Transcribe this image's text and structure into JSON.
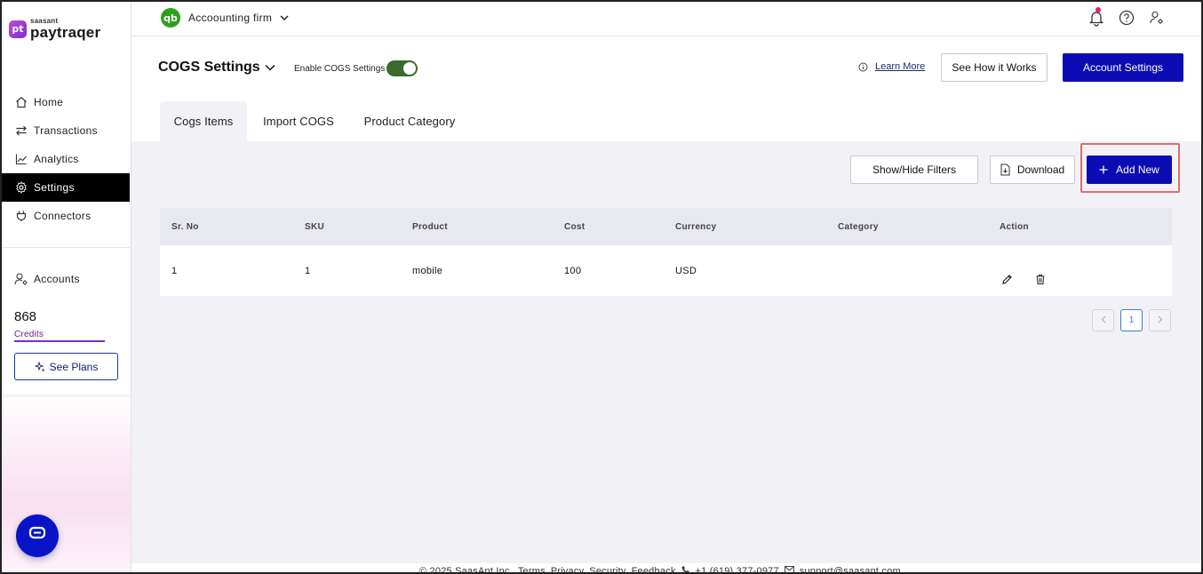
{
  "app": {
    "brand_small": "saasant",
    "brand_name": "paytraqer",
    "brand_badge": "pt"
  },
  "sidebar": {
    "items": [
      {
        "label": "Home",
        "icon": "home-icon"
      },
      {
        "label": "Transactions",
        "icon": "transfer-arrows-icon"
      },
      {
        "label": "Analytics",
        "icon": "chart-line-icon"
      },
      {
        "label": "Settings",
        "icon": "gear-icon",
        "active": true
      },
      {
        "label": "Connectors",
        "icon": "plug-icon"
      }
    ],
    "accounts_label": "Accounts",
    "credits_value": "868",
    "credits_label": "Credits",
    "see_plans_label": "See Plans"
  },
  "topbar": {
    "company_badge": "qb",
    "company_name": "Accoounting firm"
  },
  "header": {
    "title": "COGS Settings",
    "enable_label": "Enable COGS Settings",
    "enable_on": true,
    "learn_more": "Learn More",
    "see_how": "See How it Works",
    "account_settings": "Account Settings"
  },
  "tabs": [
    {
      "label": "Cogs Items",
      "active": true
    },
    {
      "label": "Import COGS"
    },
    {
      "label": "Product Category"
    }
  ],
  "toolbar": {
    "filters": "Show/Hide Filters",
    "download": "Download",
    "add_new": "Add New"
  },
  "table": {
    "headers": [
      "Sr. No",
      "SKU",
      "Product",
      "Cost",
      "Currency",
      "Category",
      "Action"
    ],
    "rows": [
      {
        "sr": "1",
        "sku": "1",
        "product": "mobile",
        "cost": "100",
        "currency": "USD",
        "category": ""
      }
    ]
  },
  "pagination": {
    "current": "1"
  },
  "footer": {
    "copyright": "© 2025 SaasAnt Inc.",
    "terms": "Terms",
    "privacy": "Privacy",
    "security": "Security",
    "feedback": "Feedback",
    "phone": "+1 (619) 377-0977",
    "email": "support@saasant.com"
  },
  "colors": {
    "primary": "#0c0cb4",
    "active_nav": "#000000",
    "toggle_on": "#3a6b2d",
    "highlight": "#e06c6c",
    "content_bg": "#f1f1f6"
  }
}
